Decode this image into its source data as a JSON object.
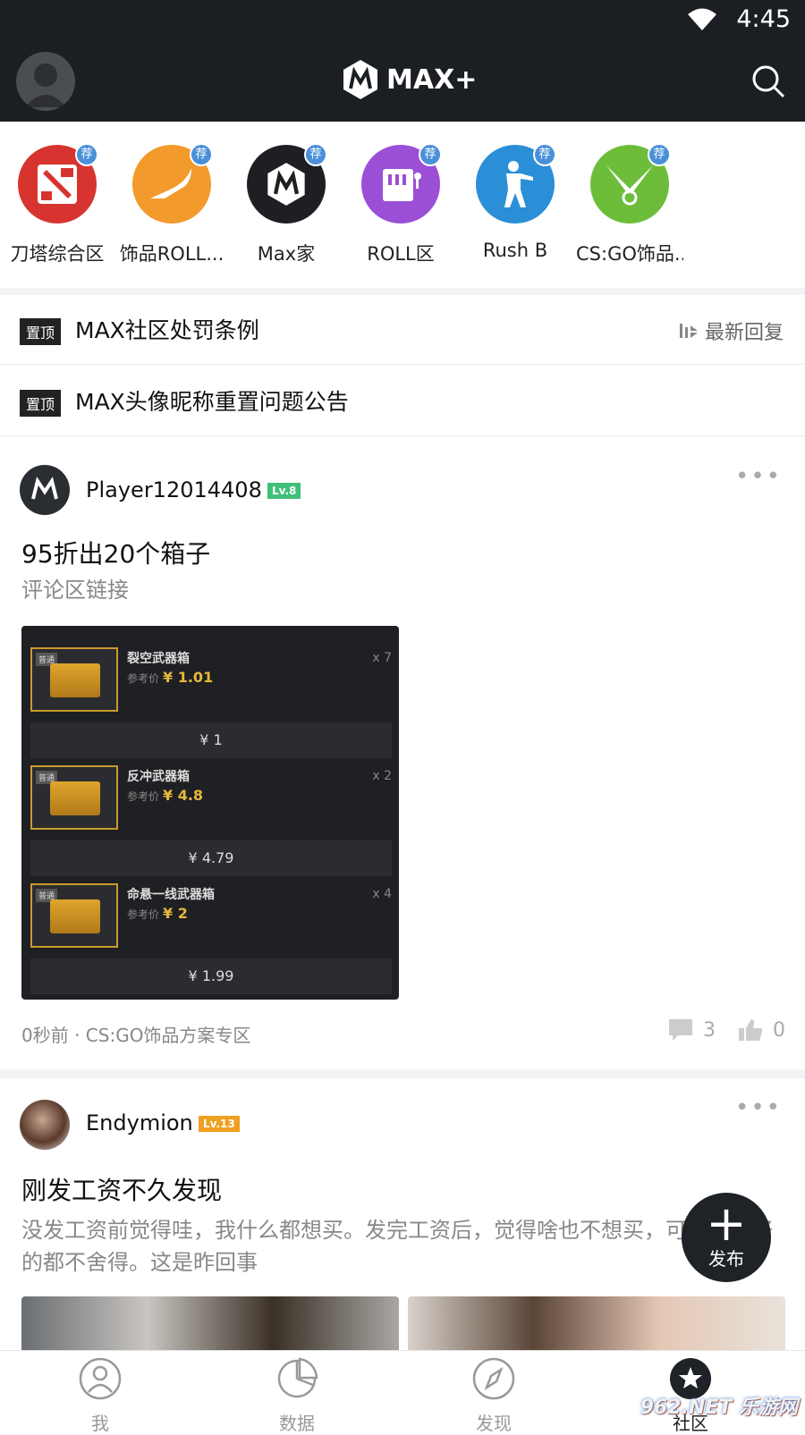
{
  "status": {
    "time": "4:45"
  },
  "header": {
    "logo_text": "MAX+"
  },
  "communities": [
    {
      "label": "刀塔综合区",
      "badge": "荐",
      "color": "#d8342f",
      "icon": "dota-icon"
    },
    {
      "label": "饰品ROLL...",
      "badge": "荐",
      "color": "#f39a2c",
      "icon": "scythe-icon"
    },
    {
      "label": "Max家",
      "badge": "荐",
      "color": "#1d1f22",
      "icon": "max-logo-icon"
    },
    {
      "label": "ROLL区",
      "badge": "荐",
      "color": "#9b4fd6",
      "icon": "slot-machine-icon"
    },
    {
      "label": "Rush B",
      "badge": "荐",
      "color": "#2a8fd6",
      "icon": "soldier-icon"
    },
    {
      "label": "CS:GO饰品...",
      "badge": "荐",
      "color": "#6dbd3a",
      "icon": "knives-icon"
    }
  ],
  "pinned": [
    {
      "tag": "置顶",
      "text": "MAX社区处罚条例"
    },
    {
      "tag": "置顶",
      "text": "MAX头像昵称重置问题公告"
    }
  ],
  "sort_label": "最新回复",
  "posts": [
    {
      "user": "Player12014408",
      "level": "Lv.8",
      "level_color": "#3fbf7a",
      "title": "95折出20个箱子",
      "body": "评论区链接",
      "crates": [
        {
          "tag": "普通",
          "name": "裂空武器箱",
          "ref_label": "参考价",
          "ref_price": "¥ 1.01",
          "qty": "x 7",
          "price": "¥  1"
        },
        {
          "tag": "普通",
          "name": "反冲武器箱",
          "ref_label": "参考价",
          "ref_price": "¥ 4.8",
          "qty": "x 2",
          "price": "¥  4.79"
        },
        {
          "tag": "普通",
          "name": "命悬一线武器箱",
          "ref_label": "参考价",
          "ref_price": "¥ 2",
          "qty": "x 4",
          "price": "¥  1.99"
        }
      ],
      "meta": "0秒前 · CS:GO饰品方案专区",
      "comments": "3",
      "likes": "0"
    },
    {
      "user": "Endymion",
      "level": "Lv.13",
      "level_color": "#f0a020",
      "title": "刚发工资不久发现",
      "body": "没发工资前觉得哇，我什么都想买。发完工资后，觉得啥也不想买，可能吃顿好的都不舍得。这是昨回事"
    }
  ],
  "fab": {
    "label": "发布"
  },
  "tabs": [
    {
      "label": "我",
      "icon": "person-icon"
    },
    {
      "label": "数据",
      "icon": "pie-chart-icon"
    },
    {
      "label": "发现",
      "icon": "compass-icon"
    },
    {
      "label": "社区",
      "icon": "star-icon"
    }
  ],
  "watermark": "962.NET 乐游网"
}
